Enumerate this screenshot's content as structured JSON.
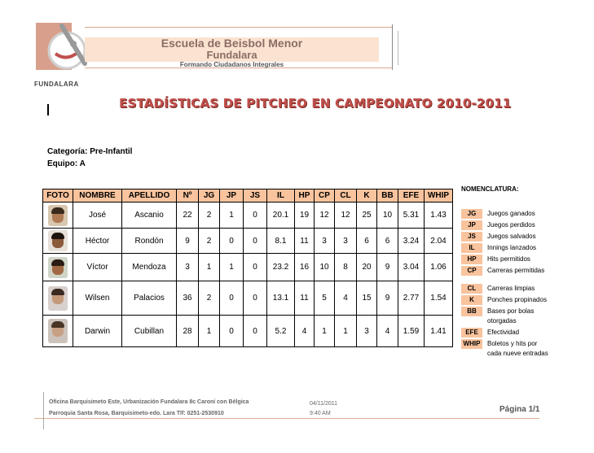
{
  "header": {
    "logo_text": "FUNDALARA",
    "school_name": "Escuela de Beisbol Menor",
    "school_org": "Fundalara",
    "motto": "Formando Ciudadanos Integrales"
  },
  "title": "ESTADÍSTICAS DE PITCHEO EN CAMPEONATO 2010-2011",
  "category": "Categoría: Pre-Infantil",
  "team": "Equipo: A",
  "table": {
    "headers": [
      "FOTO",
      "NOMBRE",
      "APELLIDO",
      "Nº",
      "JG",
      "JP",
      "JS",
      "IL",
      "HP",
      "CP",
      "CL",
      "K",
      "BB",
      "EFE",
      "WHIP"
    ],
    "rows": [
      {
        "nombre": "José",
        "apellido": "Ascanio",
        "no": "22",
        "jg": "2",
        "jp": "1",
        "js": "0",
        "il": "20.1",
        "hp": "19",
        "cp": "12",
        "cl": "12",
        "k": "25",
        "bb": "10",
        "efe": "5.31",
        "whip": "1.43"
      },
      {
        "nombre": "Héctor",
        "apellido": "Rondón",
        "no": "9",
        "jg": "2",
        "jp": "0",
        "js": "0",
        "il": "8.1",
        "hp": "11",
        "cp": "3",
        "cl": "3",
        "k": "6",
        "bb": "6",
        "efe": "3.24",
        "whip": "2.04"
      },
      {
        "nombre": "Víctor",
        "apellido": "Mendoza",
        "no": "3",
        "jg": "1",
        "jp": "1",
        "js": "0",
        "il": "23.2",
        "hp": "16",
        "cp": "10",
        "cl": "8",
        "k": "20",
        "bb": "9",
        "efe": "3.04",
        "whip": "1.06"
      },
      {
        "nombre": "Wilsen",
        "apellido": "Palacios",
        "no": "36",
        "jg": "2",
        "jp": "0",
        "js": "0",
        "il": "13.1",
        "hp": "11",
        "cp": "5",
        "cl": "4",
        "k": "15",
        "bb": "9",
        "efe": "2.77",
        "whip": "1.54"
      },
      {
        "nombre": "Darwin",
        "apellido": "Cubillan",
        "no": "28",
        "jg": "1",
        "jp": "0",
        "js": "0",
        "il": "5.2",
        "hp": "4",
        "cp": "1",
        "cl": "1",
        "k": "3",
        "bb": "4",
        "efe": "1.59",
        "whip": "1.41"
      }
    ]
  },
  "nomenclature": {
    "title": "NOMENCLATURA:",
    "items": [
      {
        "code": "JG",
        "desc": "Juegos ganados"
      },
      {
        "code": "JP",
        "desc": "Juegos perdidos"
      },
      {
        "code": "JS",
        "desc": "Juegos salvados"
      },
      {
        "code": "IL",
        "desc": "Innings lanzados"
      },
      {
        "code": "HP",
        "desc": "Hits permitidos"
      },
      {
        "code": "CP",
        "desc": "Carreras  permitidas"
      },
      {
        "code": "CL",
        "desc": "Carreras  limpias"
      },
      {
        "code": "K",
        "desc": "Ponches propinados"
      },
      {
        "code": "BB",
        "desc": "Bases por bolas otorgadas"
      },
      {
        "code": "EFE",
        "desc": "Efectividad"
      },
      {
        "code": "WHIP",
        "desc": "Boletos y hits por cada nueve entradas"
      }
    ]
  },
  "footer": {
    "address1": "Oficina Barquisimeto Este, Urbanización  Fundalara 8c  Caroní con Bélgica",
    "address2": "Parroquia Santa Rosa, Barquisimeto-edo. Lara Tlf: 0251-2530910",
    "date": "04/11/2011",
    "time": "9:40 AM",
    "page": "Página  1/1"
  },
  "colors": {
    "accent": "#f8c39d",
    "title": "#c0504d",
    "band": "#fbe3d1"
  }
}
